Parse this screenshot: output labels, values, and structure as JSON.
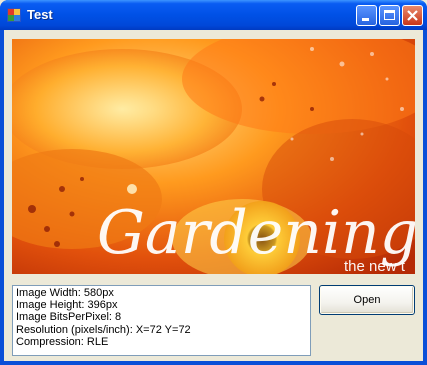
{
  "window": {
    "title": "Test"
  },
  "image": {
    "overlay_text": "Gardening C",
    "overlay_subtitle": "the new t"
  },
  "info": {
    "lines": [
      "Image Width: 580px",
      "Image Height: 396px",
      "Image BitsPerPixel: 8",
      "Resolution (pixels/inch): X=72 Y=72",
      "Compression: RLE"
    ]
  },
  "buttons": {
    "open_label": "Open"
  }
}
